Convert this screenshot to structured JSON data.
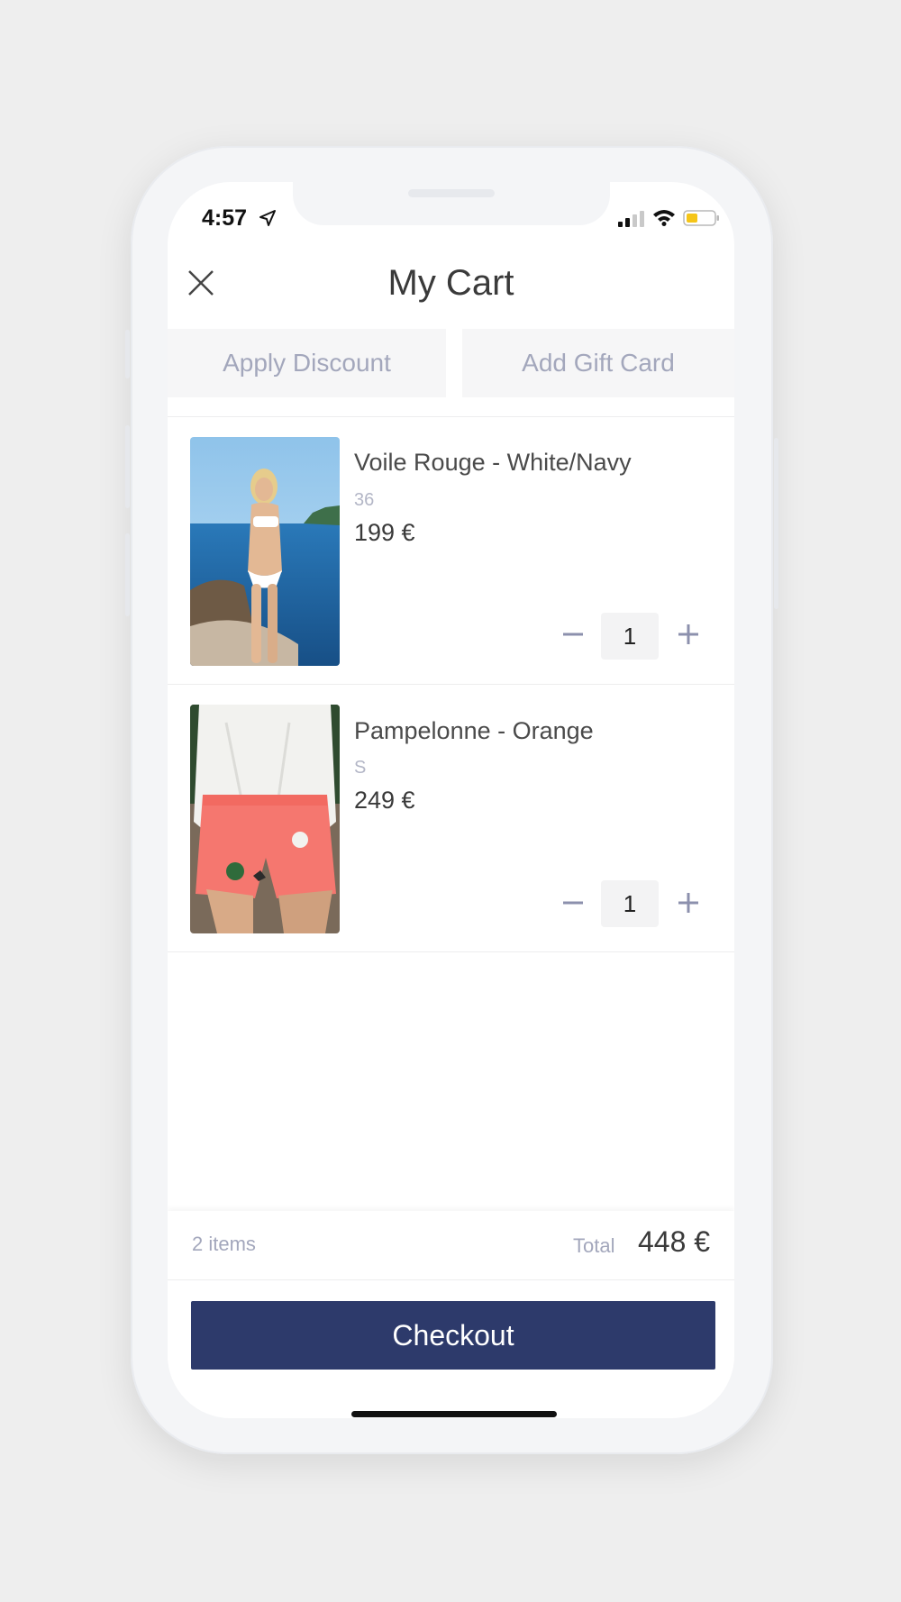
{
  "status_bar": {
    "time": "4:57"
  },
  "header": {
    "title": "My Cart"
  },
  "actions": {
    "apply_discount": "Apply Discount",
    "add_gift_card": "Add Gift Card"
  },
  "items": [
    {
      "name": "Voile Rouge - White/Navy",
      "size": "36",
      "price": "199 €",
      "quantity": "1"
    },
    {
      "name": "Pampelonne - Orange",
      "size": "S",
      "price": "249 €",
      "quantity": "1"
    }
  ],
  "footer": {
    "items_count": "2 items",
    "total_label": "Total",
    "total_value": "448 €",
    "checkout_label": "Checkout"
  },
  "colors": {
    "accent": "#2d3a6b",
    "muted_text": "#a3a7bc",
    "battery": "#f5c518"
  }
}
